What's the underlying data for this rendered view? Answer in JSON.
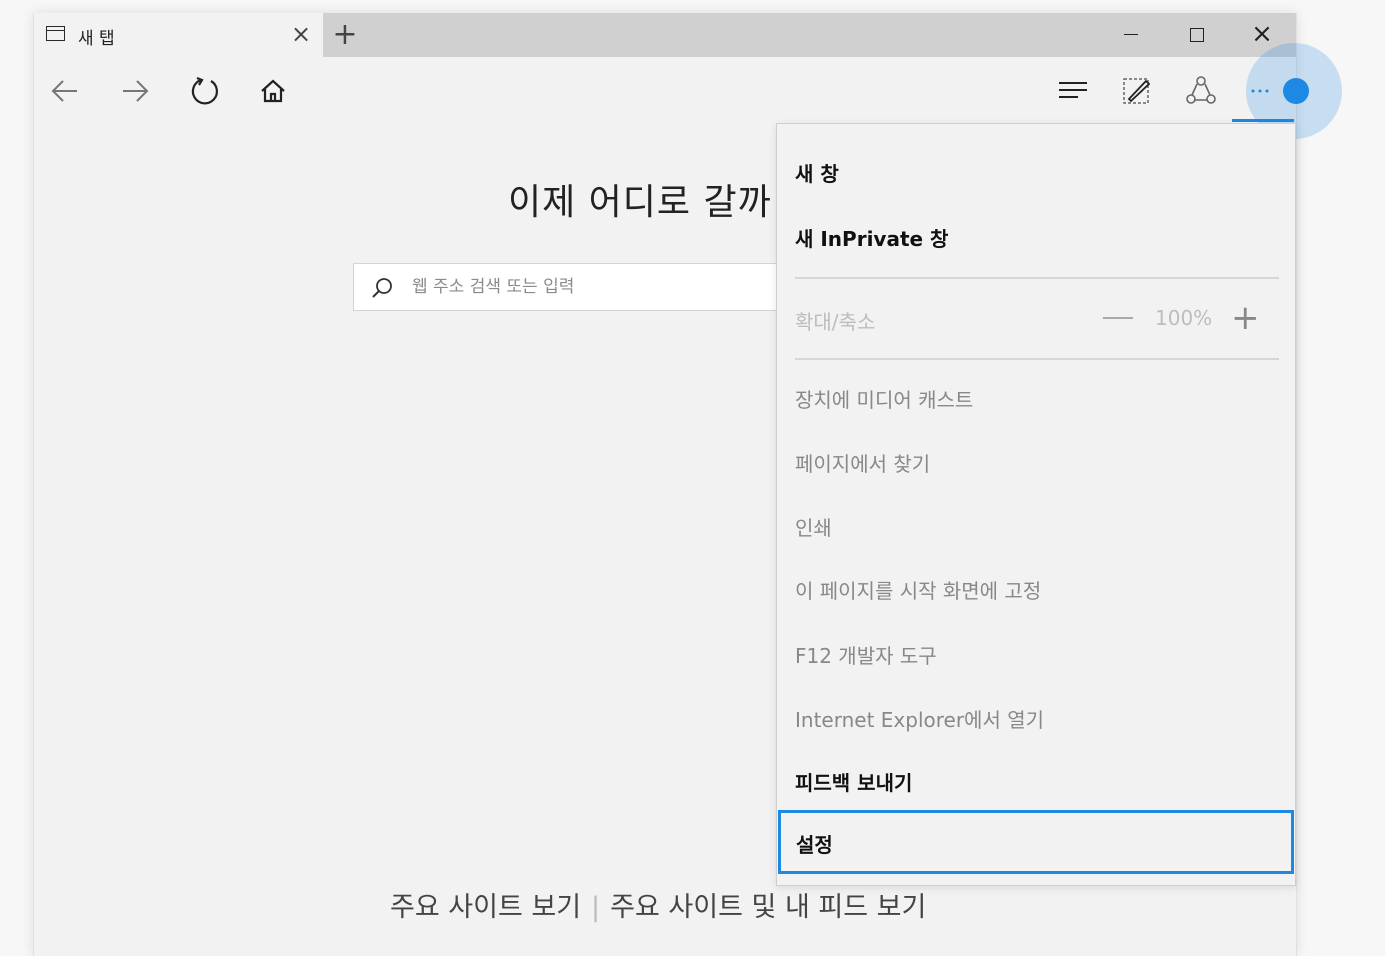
{
  "browser": {
    "tab_title": "새 탭",
    "tab_close": "×",
    "new_tab": "+",
    "window_close": "×"
  },
  "main": {
    "headline": "이제 어디로 갈까",
    "search_placeholder": "웹 주소 검색 또는 입력",
    "top_sites_link": "주요 사이트 보기",
    "separator": "|",
    "top_sites_feed_link": "주요 사이트 및 내 피드 보기"
  },
  "menu": {
    "new_window": "새 창",
    "new_inprivate_window": "새 InPrivate 창",
    "zoom_label": "확대/축소",
    "zoom_value": "100%",
    "zoom_plus": "+",
    "cast_media": "장치에 미디어 캐스트",
    "find_on_page": "페이지에서 찾기",
    "print": "인쇄",
    "pin_to_start": "이 페이지를 시작 화면에 고정",
    "dev_tools": "F12 개발자 도구",
    "open_with_ie": "Internet Explorer에서 열기",
    "send_feedback": "피드백 보내기",
    "settings": "설정"
  },
  "colors": {
    "accent": "#1e88e5",
    "disabled_text": "#888888"
  },
  "icons": [
    "back-icon",
    "forward-icon",
    "refresh-icon",
    "home-icon",
    "hub-icon",
    "web-note-icon",
    "share-icon",
    "more-icon",
    "search-icon"
  ]
}
